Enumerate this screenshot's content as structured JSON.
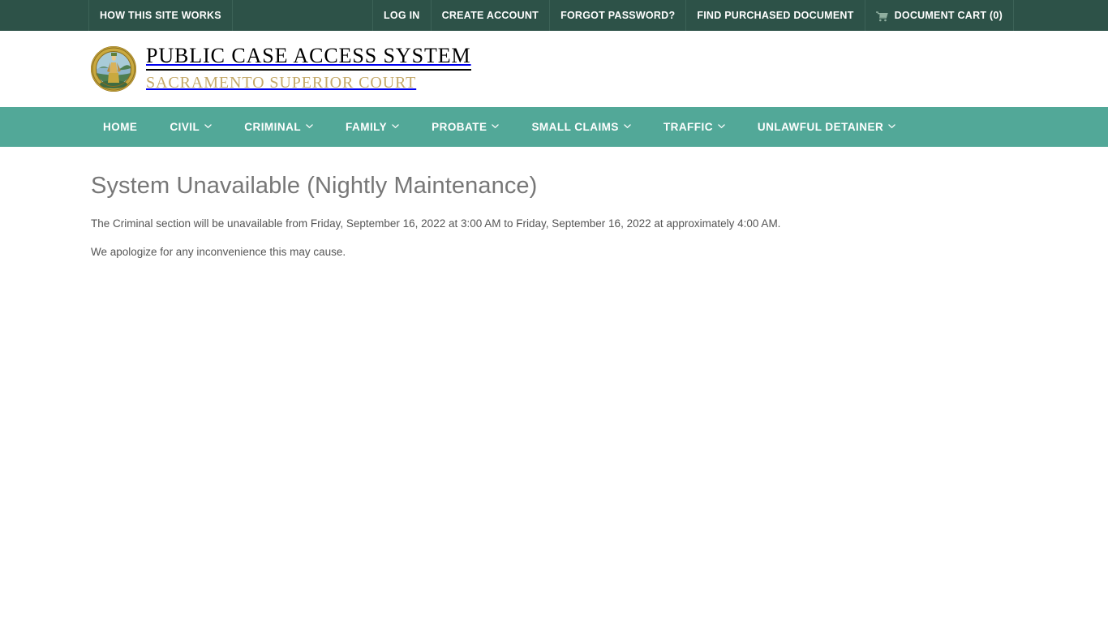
{
  "topbar": {
    "left_items": [
      {
        "label": "HOW THIS SITE WORKS",
        "icon": null
      }
    ],
    "right_items": [
      {
        "label": "LOG IN",
        "icon": null
      },
      {
        "label": "CREATE ACCOUNT",
        "icon": null
      },
      {
        "label": "FORGOT PASSWORD?",
        "icon": null
      },
      {
        "label": "FIND PURCHASED DOCUMENT",
        "icon": null
      },
      {
        "label": "DOCUMENT CART (0)",
        "icon": "shopping-cart-icon"
      }
    ],
    "cart_count": "0",
    "background_color": "#2d5248",
    "text_color": "#ffffff"
  },
  "header": {
    "logo_alt": "county-of-sacramento-superior-court-seal",
    "title": "PUBLIC CASE ACCESS SYSTEM",
    "subtitle": "SACRAMENTO SUPERIOR COURT",
    "subtitle_color": "#c4a96a"
  },
  "mainnav": {
    "background_color": "#52a898",
    "items": [
      {
        "label": "HOME",
        "has_dropdown": false
      },
      {
        "label": "CIVIL",
        "has_dropdown": true
      },
      {
        "label": "CRIMINAL",
        "has_dropdown": true
      },
      {
        "label": "FAMILY",
        "has_dropdown": true
      },
      {
        "label": "PROBATE",
        "has_dropdown": true
      },
      {
        "label": "SMALL CLAIMS",
        "has_dropdown": true
      },
      {
        "label": "TRAFFIC",
        "has_dropdown": true
      },
      {
        "label": "UNLAWFUL DETAINER",
        "has_dropdown": true
      }
    ]
  },
  "main": {
    "page_title": "System Unavailable (Nightly Maintenance)",
    "paragraph_1": "The Criminal section will be unavailable from Friday, September 16, 2022 at 3:00 AM to Friday, September 16, 2022 at approximately 4:00 AM.",
    "paragraph_2": "We apologize for any inconvenience this may cause.",
    "title_color": "#777777",
    "text_color": "#555555"
  }
}
